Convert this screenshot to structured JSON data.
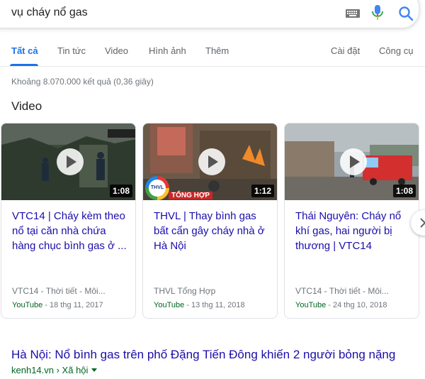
{
  "search": {
    "query": "vụ cháy nổ gas"
  },
  "tabs": [
    {
      "label": "Tất cả",
      "active": true
    },
    {
      "label": "Tin tức"
    },
    {
      "label": "Video"
    },
    {
      "label": "Hình ảnh"
    },
    {
      "label": "Thêm"
    },
    {
      "label": "Cài đặt"
    },
    {
      "label": "Công cụ"
    }
  ],
  "result_stats": "Khoảng 8.070.000 kết quả (0,36 giây)",
  "video_section": {
    "title": "Video",
    "cards": [
      {
        "title": "VTC14 | Cháy kèm theo nổ tại căn nhà chứa hàng chục bình gas ở ...",
        "duration": "1:08",
        "channel": "VTC14 - Thời tiết - Môi...",
        "source": "YouTube",
        "date": " - 18 thg 11, 2017",
        "thumb_icon": "night-fire-scene-thumbnail"
      },
      {
        "title": "THVL | Thay bình gas bất cẩn gây cháy nhà ở Hà Nội",
        "duration": "1:12",
        "channel": "THVL Tổng Hợp",
        "source": "YouTube",
        "date": " - 13 thg 11, 2018",
        "thumb_overlay": "TỔNG HỢP",
        "thumb_logo": "THVL"
      },
      {
        "title": "Thái Nguyên: Cháy nổ khí gas, hai người bị thương | VTC14",
        "duration": "1:08",
        "channel": "VTC14 - Thời tiết - Môi...",
        "source": "YouTube",
        "date": " - 24 thg 10, 2018",
        "thumb_icon": "fire-truck-thumbnail"
      }
    ]
  },
  "result": {
    "title": "Hà Nội: Nổ bình gas trên phố Đặng Tiến Đông khiến 2 người bỏng nặng",
    "url": "kenh14.vn",
    "breadcrumb": " › Xã hội"
  },
  "colors": {
    "link": "#1a0dab",
    "accent": "#1a73e8",
    "url": "#006621",
    "muted": "#70757a"
  }
}
